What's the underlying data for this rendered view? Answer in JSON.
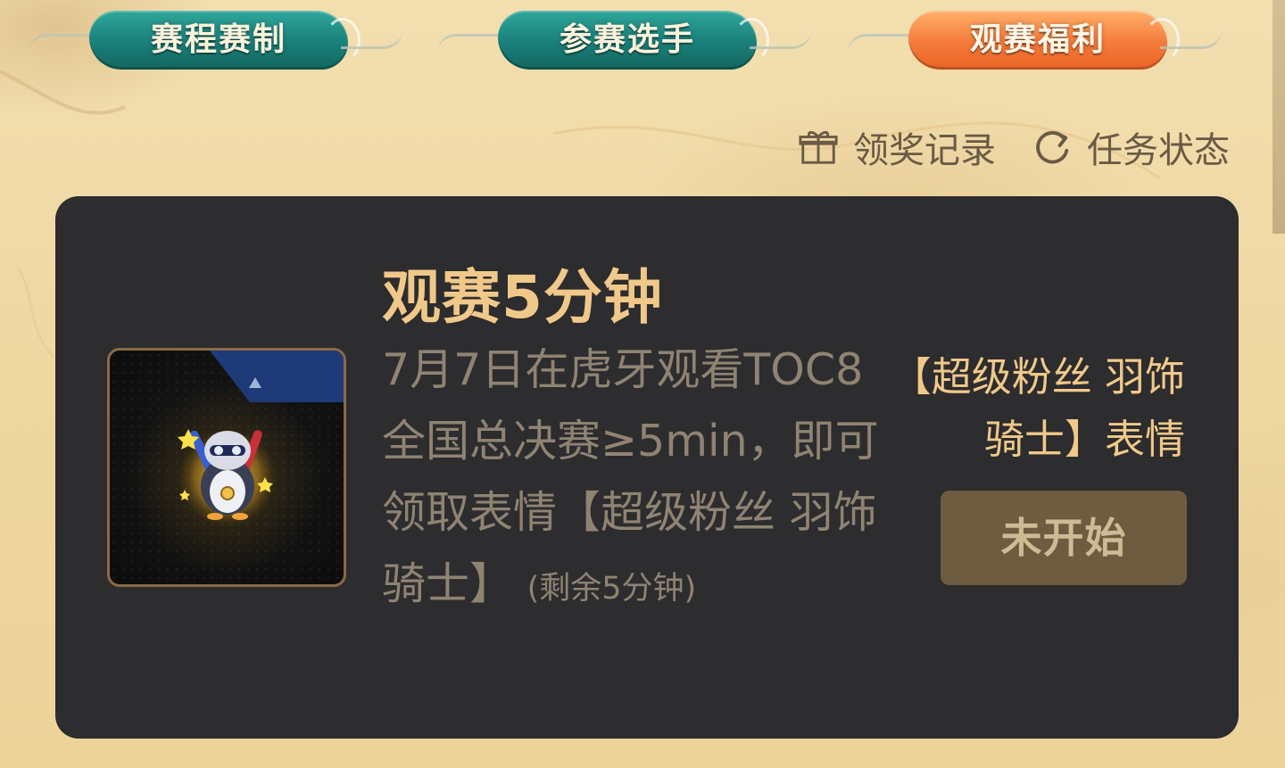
{
  "tabs": [
    {
      "label": "赛程赛制"
    },
    {
      "label": "参赛选手"
    },
    {
      "label": "观赛福利"
    }
  ],
  "links": {
    "reward_record": "领奖记录",
    "task_status": "任务状态"
  },
  "task": {
    "title": "观赛5分钟",
    "description": "7月7日在虎牙观看TOC8全国总决赛≥5min，即可领取表情【超级粉丝 羽饰骑士】",
    "remaining": "(剩余5分钟)",
    "reward": "【超级粉丝 羽饰骑士】表情",
    "button_label": "未开始"
  },
  "colors": {
    "tab_active": "#f57a3b",
    "tab_inactive": "#1a7f7a",
    "card_bg": "#2d2c2e",
    "title_gold": "#f0c98a",
    "desc_gray": "#8f8373",
    "button_bg": "#6e5c40"
  },
  "icons": {
    "reward_record": "gift-icon",
    "task_status": "refresh-icon"
  }
}
